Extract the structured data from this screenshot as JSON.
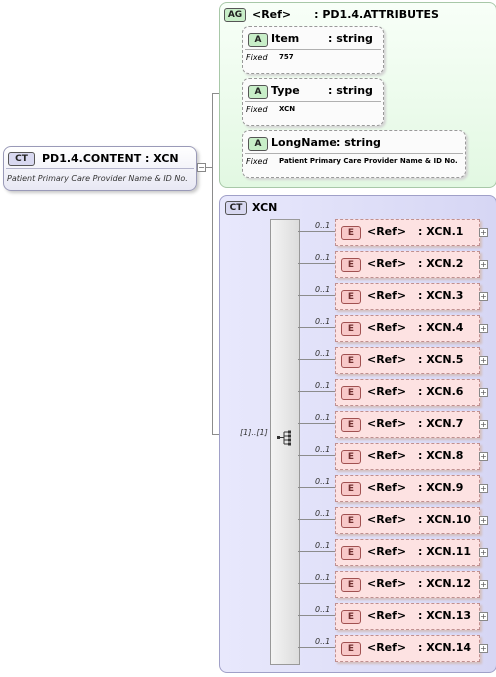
{
  "root": {
    "badge": "CT",
    "title": "PD1.4.CONTENT : XCN",
    "doc": "Patient Primary Care Provider Name & ID No."
  },
  "attribute_group": {
    "badge": "AG",
    "title": "<Ref>      : PD1.4.ATTRIBUTES",
    "attributes": [
      {
        "badge": "A",
        "name": "Item",
        "type": ": string",
        "fixed_label": "Fixed",
        "fixed_value": "757"
      },
      {
        "badge": "A",
        "name": "Type",
        "type": ": string",
        "fixed_label": "Fixed",
        "fixed_value": "XCN"
      },
      {
        "badge": "A",
        "name": "LongName",
        "type": ": string",
        "fixed_label": "Fixed",
        "fixed_value": "Patient Primary Care Provider Name & ID No."
      }
    ]
  },
  "complex_type": {
    "badge": "CT",
    "title": "XCN",
    "cardinality": "[1]..[1]",
    "elements": [
      {
        "badge": "E",
        "occurs": "0..1",
        "ref": "<Ref>",
        "type": ": XCN.1"
      },
      {
        "badge": "E",
        "occurs": "0..1",
        "ref": "<Ref>",
        "type": ": XCN.2"
      },
      {
        "badge": "E",
        "occurs": "0..1",
        "ref": "<Ref>",
        "type": ": XCN.3"
      },
      {
        "badge": "E",
        "occurs": "0..1",
        "ref": "<Ref>",
        "type": ": XCN.4"
      },
      {
        "badge": "E",
        "occurs": "0..1",
        "ref": "<Ref>",
        "type": ": XCN.5"
      },
      {
        "badge": "E",
        "occurs": "0..1",
        "ref": "<Ref>",
        "type": ": XCN.6"
      },
      {
        "badge": "E",
        "occurs": "0..1",
        "ref": "<Ref>",
        "type": ": XCN.7"
      },
      {
        "badge": "E",
        "occurs": "0..1",
        "ref": "<Ref>",
        "type": ": XCN.8"
      },
      {
        "badge": "E",
        "occurs": "0..1",
        "ref": "<Ref>",
        "type": ": XCN.9"
      },
      {
        "badge": "E",
        "occurs": "0..1",
        "ref": "<Ref>",
        "type": ": XCN.10"
      },
      {
        "badge": "E",
        "occurs": "0..1",
        "ref": "<Ref>",
        "type": ": XCN.11"
      },
      {
        "badge": "E",
        "occurs": "0..1",
        "ref": "<Ref>",
        "type": ": XCN.12"
      },
      {
        "badge": "E",
        "occurs": "0..1",
        "ref": "<Ref>",
        "type": ": XCN.13"
      },
      {
        "badge": "E",
        "occurs": "0..1",
        "ref": "<Ref>",
        "type": ": XCN.14"
      }
    ]
  }
}
